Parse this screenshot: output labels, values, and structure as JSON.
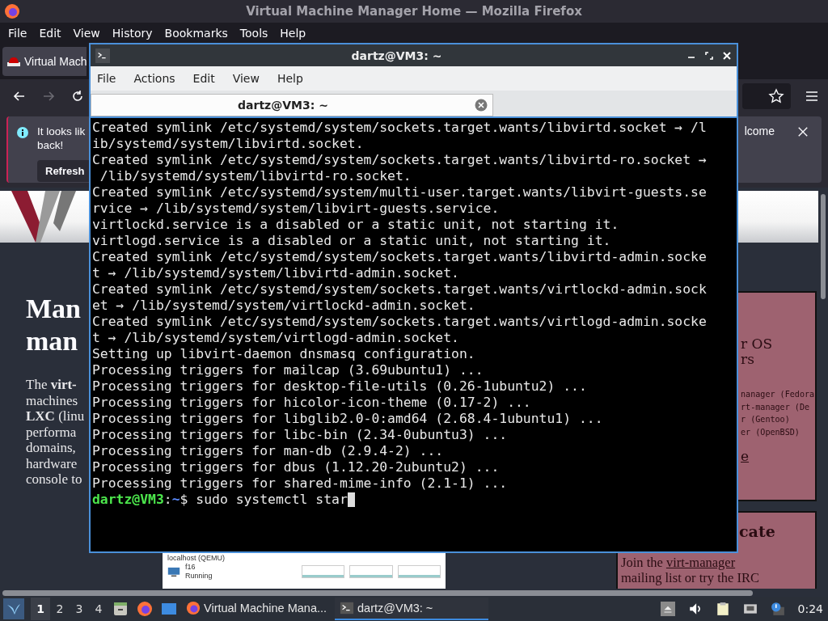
{
  "browser": {
    "title": "Virtual Machine Manager Home — Mozilla Firefox",
    "menu": [
      "File",
      "Edit",
      "View",
      "History",
      "Bookmarks",
      "Tools",
      "Help"
    ],
    "tab": {
      "title": "Virtual Mach"
    },
    "notification": {
      "lines": [
        "It looks lik",
        "back!"
      ],
      "trailing": "lcome",
      "button": "Refresh"
    },
    "page": {
      "heading_lines": [
        "Man",
        "man"
      ],
      "intro_lines": [
        "The **virt-**",
        "machines",
        "**LXC** (linu",
        "performa",
        "domains,",
        "hardware",
        "console to"
      ],
      "screenshot": {
        "group": "localhost (QEMU)",
        "vm_name": "f16",
        "vm_state": "Running"
      },
      "side_box": {
        "lines": [
          "r OS",
          "rs"
        ],
        "code_lines": [
          "nanager (Fedora",
          "rt-manager (De",
          "r (Gentoo)",
          "er (OpenBSD)"
        ],
        "link": "e"
      },
      "contact_box": {
        "heading": "cate",
        "text": "Join the ",
        "link": "virt-manager",
        "line2": "mailing list or try the IRC"
      }
    }
  },
  "terminal": {
    "title": "dartz@VM3: ~",
    "menu": [
      "File",
      "Actions",
      "Edit",
      "View",
      "Help"
    ],
    "tab": {
      "title": "dartz@VM3: ~"
    },
    "output": [
      "Created symlink /etc/systemd/system/sockets.target.wants/libvirtd.socket → /l",
      "ib/systemd/system/libvirtd.socket.",
      "Created symlink /etc/systemd/system/sockets.target.wants/libvirtd-ro.socket →",
      " /lib/systemd/system/libvirtd-ro.socket.",
      "Created symlink /etc/systemd/system/multi-user.target.wants/libvirt-guests.se",
      "rvice → /lib/systemd/system/libvirt-guests.service.",
      "virtlockd.service is a disabled or a static unit, not starting it.",
      "virtlogd.service is a disabled or a static unit, not starting it.",
      "Created symlink /etc/systemd/system/sockets.target.wants/libvirtd-admin.socke",
      "t → /lib/systemd/system/libvirtd-admin.socket.",
      "Created symlink /etc/systemd/system/sockets.target.wants/virtlockd-admin.sock",
      "et → /lib/systemd/system/virtlockd-admin.socket.",
      "Created symlink /etc/systemd/system/sockets.target.wants/virtlogd-admin.socke",
      "t → /lib/systemd/system/virtlogd-admin.socket.",
      "Setting up libvirt-daemon dnsmasq configuration.",
      "Processing triggers for mailcap (3.69ubuntu1) ...",
      "Processing triggers for desktop-file-utils (0.26-1ubuntu2) ...",
      "Processing triggers for hicolor-icon-theme (0.17-2) ...",
      "Processing triggers for libglib2.0-0:amd64 (2.68.4-1ubuntu1) ...",
      "Processing triggers for libc-bin (2.34-0ubuntu3) ...",
      "Processing triggers for man-db (2.9.4-2) ...",
      "Processing triggers for dbus (1.12.20-2ubuntu2) ...",
      "Processing triggers for shared-mime-info (2.1-1) ..."
    ],
    "prompt": {
      "user": "dartz@VM3",
      "separator": ":",
      "path": "~",
      "symbol": "$",
      "command": "sudo systemctl star"
    }
  },
  "taskbar": {
    "workspaces": [
      {
        "label": "1",
        "selected": true
      },
      {
        "label": "2",
        "selected": false
      },
      {
        "label": "3",
        "selected": false
      },
      {
        "label": "4",
        "selected": false
      }
    ],
    "tasks": [
      {
        "title": "Virtual Machine Mana...",
        "kind": "browser",
        "selected": false
      },
      {
        "title": "dartz@VM3: ~",
        "kind": "terminal",
        "selected": true
      }
    ],
    "clock": "0:24"
  }
}
